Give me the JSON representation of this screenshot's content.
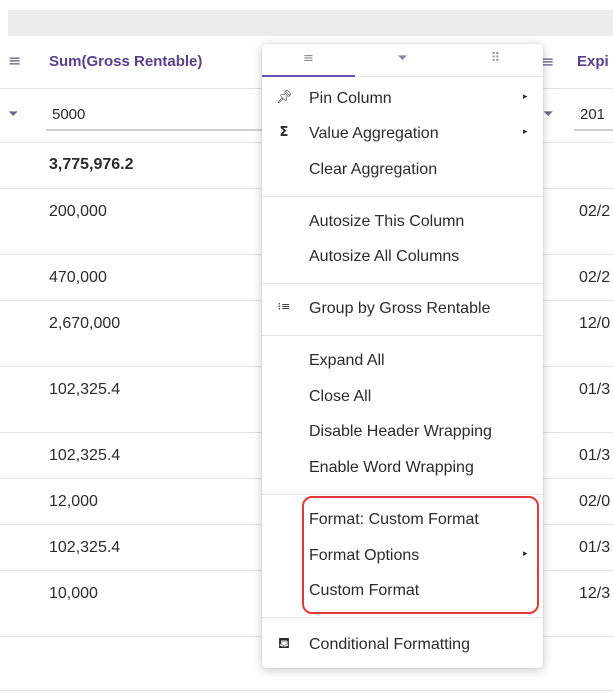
{
  "grid": {
    "column": {
      "title": "Sum(Gross Rentable)",
      "menu_icon": "hamburger-menu-icon",
      "filter_icon": "filter-icon",
      "filter_value": "5000"
    },
    "right_column": {
      "title": "Expi",
      "menu_icon": "hamburger-menu-icon",
      "filter_value": "201"
    },
    "total": "3,775,976.2",
    "rows": [
      {
        "value": "200,000",
        "right": "02/2"
      },
      {
        "value": "470,000",
        "right": "02/2"
      },
      {
        "value": "2,670,000",
        "right": "12/0"
      },
      {
        "value": "102,325.4",
        "right": "01/3"
      },
      {
        "value": "102,325.4",
        "right": "01/3"
      },
      {
        "value": "12,000",
        "right": "02/0"
      },
      {
        "value": "102,325.4",
        "right": "01/3"
      },
      {
        "value": "10,000",
        "right": "12/3"
      }
    ]
  },
  "menu": {
    "tabs": [
      {
        "icon": "general-menu-icon",
        "glyph": "≡"
      },
      {
        "icon": "filter-icon",
        "glyph": "⏷"
      },
      {
        "icon": "columns-grid-icon",
        "glyph": "⠿"
      }
    ],
    "items": {
      "pin_column": "Pin Column",
      "value_aggregation": "Value Aggregation",
      "clear_aggregation": "Clear Aggregation",
      "autosize_this": "Autosize This Column",
      "autosize_all": "Autosize All Columns",
      "group_by": "Group by Gross Rentable",
      "expand_all": "Expand All",
      "close_all": "Close All",
      "disable_header_wrapping": "Disable Header Wrapping",
      "enable_word_wrapping": "Enable Word Wrapping",
      "format_custom": "Format: Custom Format",
      "format_options": "Format Options",
      "custom_format": "Custom Format",
      "conditional_formatting": "Conditional Formatting"
    },
    "highlight_color": "#e53935",
    "accent_color": "#6b4fb8"
  }
}
